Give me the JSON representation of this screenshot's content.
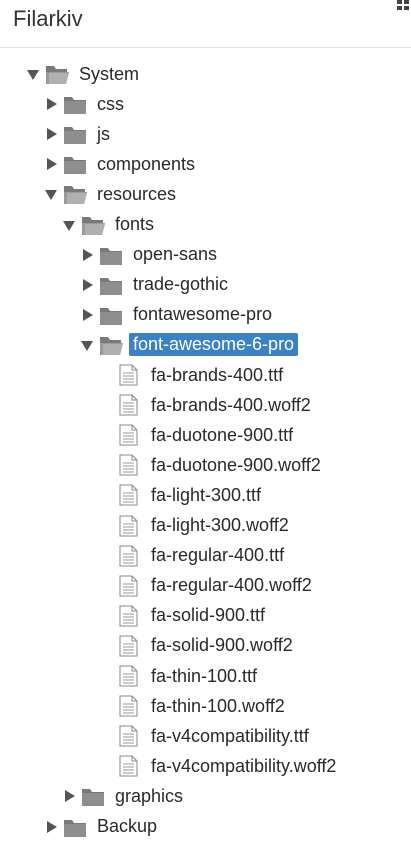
{
  "header": {
    "title": "Filarkiv",
    "menu_icon": "grid-icon"
  },
  "tree": {
    "nodes": [
      {
        "label": "System",
        "type": "folder-open",
        "expanded": true
      },
      {
        "label": "css",
        "type": "folder",
        "expanded": false
      },
      {
        "label": "js",
        "type": "folder",
        "expanded": false
      },
      {
        "label": "components",
        "type": "folder",
        "expanded": false
      },
      {
        "label": "resources",
        "type": "folder-open",
        "expanded": true
      },
      {
        "label": "fonts",
        "type": "folder-open",
        "expanded": true
      },
      {
        "label": "open-sans",
        "type": "folder",
        "expanded": false
      },
      {
        "label": "trade-gothic",
        "type": "folder",
        "expanded": false
      },
      {
        "label": "fontawesome-pro",
        "type": "folder",
        "expanded": false
      },
      {
        "label": "font-awesome-6-pro",
        "type": "folder-open",
        "expanded": true,
        "selected": true
      },
      {
        "label": "fa-brands-400.ttf",
        "type": "file"
      },
      {
        "label": "fa-brands-400.woff2",
        "type": "file"
      },
      {
        "label": "fa-duotone-900.ttf",
        "type": "file"
      },
      {
        "label": "fa-duotone-900.woff2",
        "type": "file"
      },
      {
        "label": "fa-light-300.ttf",
        "type": "file"
      },
      {
        "label": "fa-light-300.woff2",
        "type": "file"
      },
      {
        "label": "fa-regular-400.ttf",
        "type": "file"
      },
      {
        "label": "fa-regular-400.woff2",
        "type": "file"
      },
      {
        "label": "fa-solid-900.ttf",
        "type": "file"
      },
      {
        "label": "fa-solid-900.woff2",
        "type": "file"
      },
      {
        "label": "fa-thin-100.ttf",
        "type": "file"
      },
      {
        "label": "fa-thin-100.woff2",
        "type": "file"
      },
      {
        "label": "fa-v4compatibility.ttf",
        "type": "file"
      },
      {
        "label": "fa-v4compatibility.woff2",
        "type": "file"
      },
      {
        "label": "graphics",
        "type": "folder",
        "expanded": false
      },
      {
        "label": "Backup",
        "type": "folder",
        "expanded": false
      }
    ]
  },
  "colors": {
    "selected_bg": "#3a82c4",
    "folder": "#7a7a7a"
  }
}
